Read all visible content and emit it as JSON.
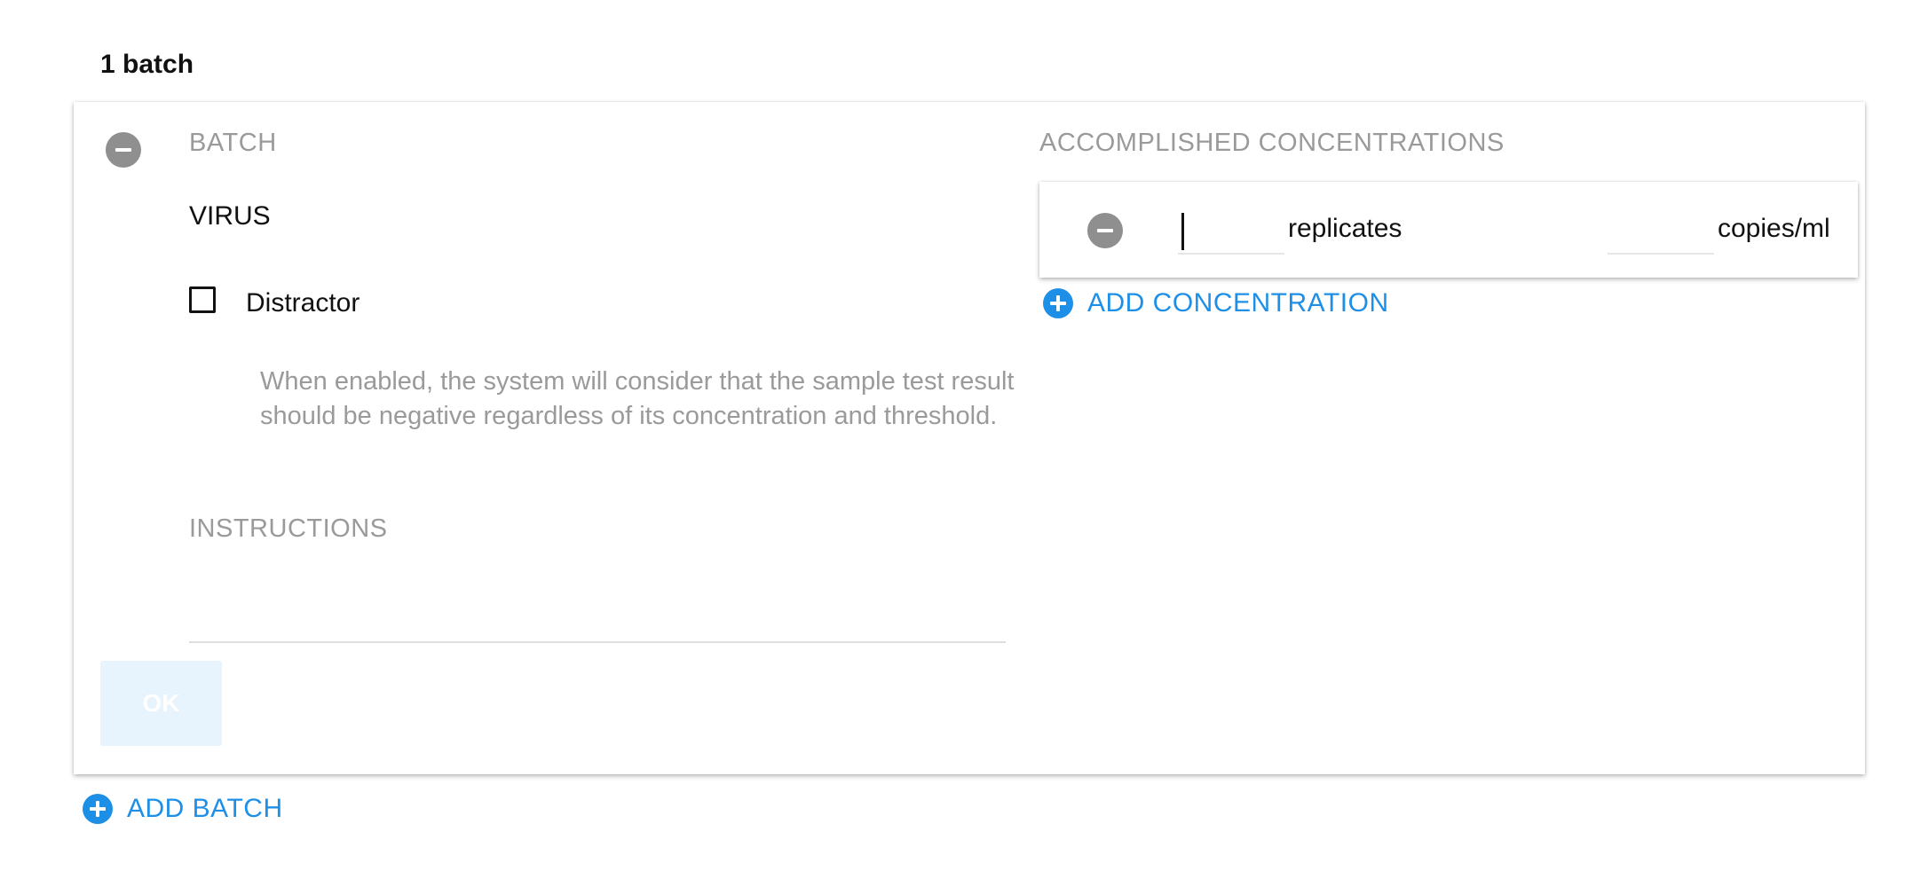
{
  "header": {
    "batch_count": "1 batch"
  },
  "batch": {
    "section_label": "BATCH",
    "virus_name": "VIRUS",
    "distractor": {
      "label": "Distractor",
      "checked": false,
      "help_text": "When enabled, the system will consider that the sample test result should be negative regardless of its concentration and threshold."
    },
    "instructions": {
      "label": "INSTRUCTIONS",
      "value": ""
    },
    "ok_label": "OK"
  },
  "concentrations": {
    "section_label": "ACCOMPLISHED CONCENTRATIONS",
    "rows": [
      {
        "replicates_value": "",
        "replicates_unit": "replicates",
        "copies_value": "",
        "copies_unit": "copies/ml"
      }
    ],
    "add_label": "ADD CONCENTRATION"
  },
  "add_batch_label": "ADD BATCH",
  "colors": {
    "accent": "#1e8fe6",
    "muted": "#9a9a9a",
    "remove_icon": "#8f8f8f",
    "ok_disabled_bg": "#e7f3fd"
  },
  "icons": {
    "remove": "minus-circle-icon",
    "add": "plus-circle-icon"
  }
}
